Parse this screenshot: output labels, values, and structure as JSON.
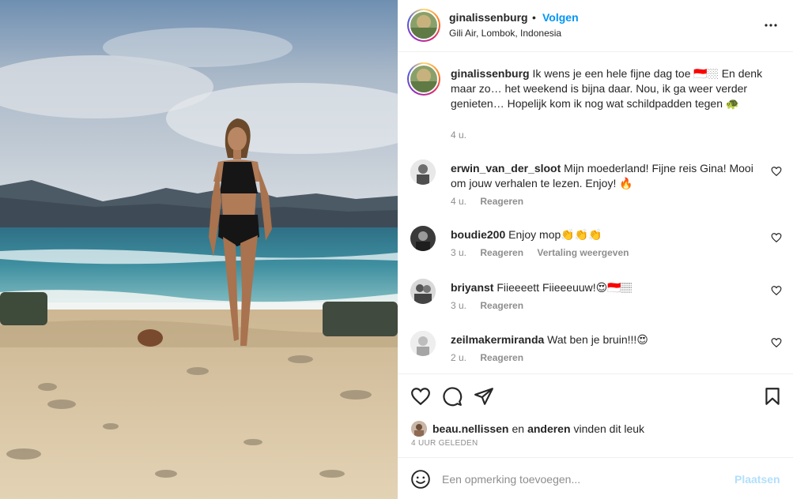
{
  "post": {
    "username": "ginalissenburg",
    "dot": "•",
    "follow_label": "Volgen",
    "location": "Gili Air, Lombok, Indonesia",
    "more_icon": "more-horizontal-icon"
  },
  "caption": {
    "username": "ginalissenburg",
    "text": " Ik wens je een hele fijne dag toe 🇮🇩🏼 En denk maar zo… het weekend is bijna daar. Nou, ik ga weer verder genieten… Hopelijk kom ik nog wat schildpadden tegen 🐢",
    "time": "4 u."
  },
  "comments": [
    {
      "username": "erwin_van_der_sloot",
      "text": " Mijn moederland! Fijne reis Gina! Mooi om jouw verhalen te lezen. Enjoy! 🔥",
      "time": "4 u.",
      "reply": "Reageren",
      "translate": ""
    },
    {
      "username": "boudie200",
      "text": " Enjoy mop👏👏👏",
      "time": "3 u.",
      "reply": "Reageren",
      "translate": "Vertaling weergeven"
    },
    {
      "username": "briyanst",
      "text": " Fiieeeett Fiieeeuuw!😍🇮🇩🏽",
      "time": "3 u.",
      "reply": "Reageren",
      "translate": ""
    },
    {
      "username": "zeilmakermiranda",
      "text": " Wat ben je bruin!!!😍",
      "time": "2 u.",
      "reply": "Reageren",
      "translate": ""
    }
  ],
  "likes": {
    "liker": "beau.nellissen",
    "connector": "en",
    "others": "anderen",
    "suffix": "vinden dit leuk",
    "ago": "4 UUR GELEDEN"
  },
  "add_comment": {
    "placeholder": "Een opmerking toevoegen...",
    "post_label": "Plaatsen"
  },
  "colors": {
    "link_blue": "#0095f6",
    "post_disabled": "#b2dffc",
    "muted": "#8e8e8e",
    "text": "#262626"
  }
}
